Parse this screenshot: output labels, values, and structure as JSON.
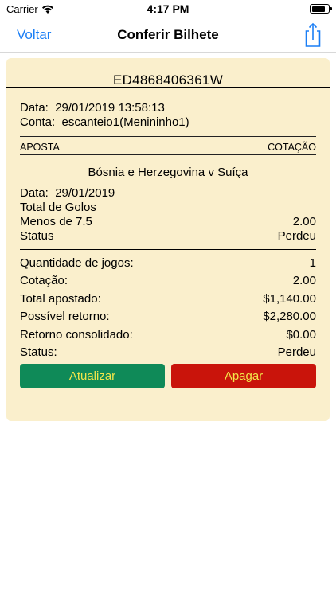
{
  "status_bar": {
    "carrier": "Carrier",
    "time": "4:17 PM",
    "icons": [
      "wifi-icon",
      "battery-icon"
    ]
  },
  "nav": {
    "back_label": "Voltar",
    "title": "Conferir Bilhete",
    "share_icon": "share-icon",
    "accent_color": "#1a7ef5"
  },
  "ticket": {
    "background_color": "#faefcc",
    "id": "ED4868406361W",
    "date_label": "Data:",
    "date_value": "29/01/2019 13:58:13",
    "account_label": "Conta:",
    "account_value": "escanteio1(Menininho1)",
    "col_bet": "APOSTA",
    "col_odds": "COTAÇÃO",
    "match": "Bósnia e Herzegovina v Suíça",
    "match_date_label": "Data:",
    "match_date_value": "29/01/2019",
    "market": "Total de Golos",
    "selection": "Menos de 7.5",
    "selection_odds": "2.00",
    "bet_status_label": "Status",
    "bet_status_value": "Perdeu",
    "summary": {
      "games_label": "Quantidade de jogos:",
      "games_value": "1",
      "odds_label": "Cotação:",
      "odds_value": "2.00",
      "staked_label": "Total apostado:",
      "staked_value": "$1,140.00",
      "possible_return_label": "Possível retorno:",
      "possible_return_value": "$2,280.00",
      "consolidated_return_label": "Retorno consolidado:",
      "consolidated_return_value": "$0.00",
      "status_label": "Status:",
      "status_value": "Perdeu"
    },
    "buttons": {
      "update_label": "Atualizar",
      "delete_label": "Apagar",
      "update_color": "#0f8a58",
      "delete_color": "#c9140b",
      "text_color": "#f2e64a"
    }
  }
}
